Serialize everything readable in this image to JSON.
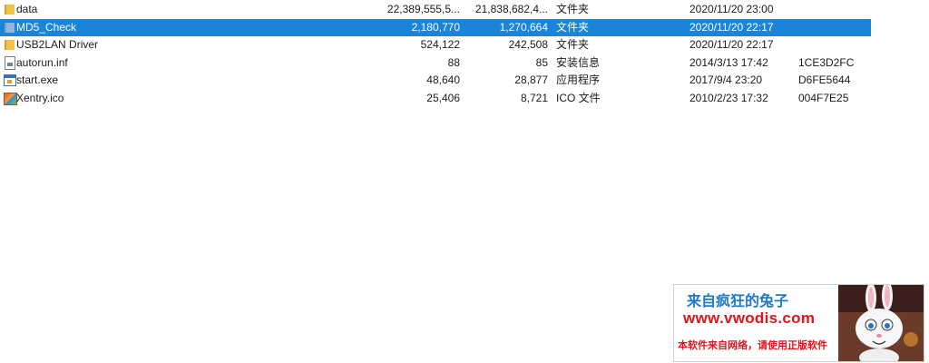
{
  "files": [
    {
      "name": "data",
      "size": "22,389,555,5...",
      "packed": "21,838,682,4...",
      "type": "文件夹",
      "modified": "2020/11/20 23:00",
      "crc": "",
      "icon": "folder-icon",
      "selected": false
    },
    {
      "name": "MD5_Check",
      "size": "2,180,770",
      "packed": "1,270,664",
      "type": "文件夹",
      "modified": "2020/11/20 22:17",
      "crc": "",
      "icon": "folder-icon",
      "selected": true
    },
    {
      "name": "USB2LAN Driver",
      "size": "524,122",
      "packed": "242,508",
      "type": "文件夹",
      "modified": "2020/11/20 22:17",
      "crc": "",
      "icon": "folder-icon",
      "selected": false
    },
    {
      "name": "autorun.inf",
      "size": "88",
      "packed": "85",
      "type": "安装信息",
      "modified": "2014/3/13 17:42",
      "crc": "1CE3D2FC",
      "icon": "inf-file-icon",
      "selected": false
    },
    {
      "name": "start.exe",
      "size": "48,640",
      "packed": "28,877",
      "type": "应用程序",
      "modified": "2017/9/4 23:20",
      "crc": "D6FE5644",
      "icon": "exe-file-icon",
      "selected": false
    },
    {
      "name": "Xentry.ico",
      "size": "25,406",
      "packed": "8,721",
      "type": "ICO 文件",
      "modified": "2010/2/23 17:32",
      "crc": "004F7E25",
      "icon": "ico-file-icon",
      "selected": false
    }
  ],
  "watermark": {
    "line1": "来自疯狂的兔子",
    "line2": "www.vwodis.com",
    "line3": "本软件来自网络，请使用正版软件",
    "image": "bunny-mascot-icon"
  },
  "colors": {
    "selection": "#1a85d8",
    "folder": "#f0c24a",
    "watermark_blue": "#1f78c8",
    "watermark_red": "#e0141b"
  }
}
